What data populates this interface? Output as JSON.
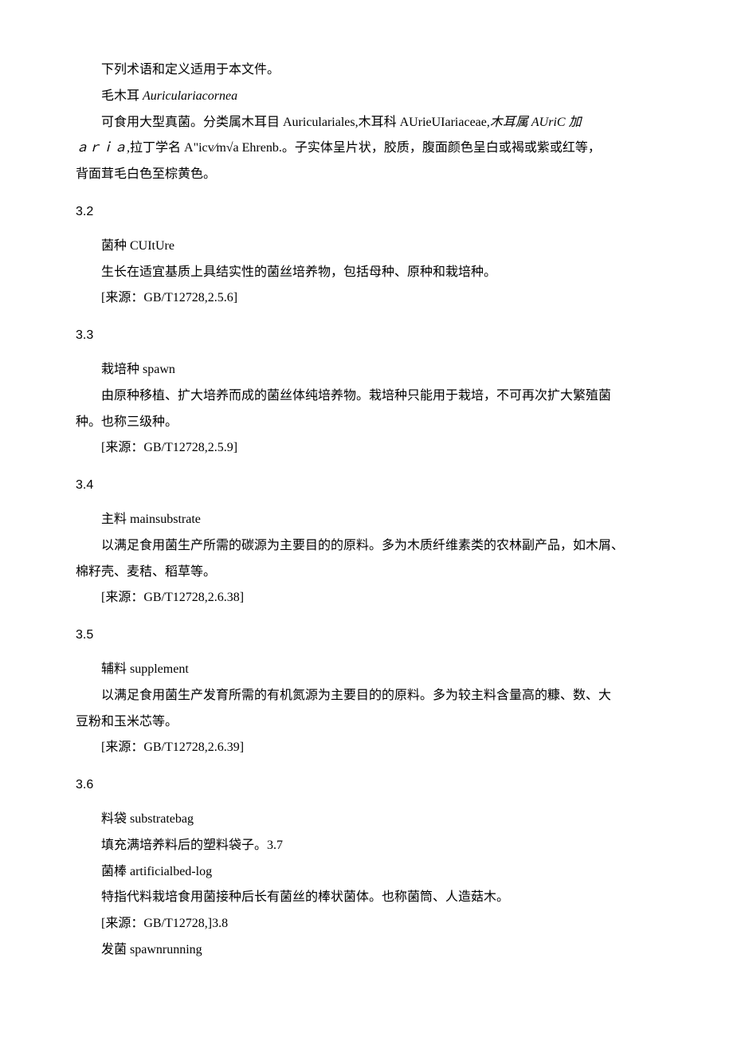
{
  "intro": {
    "line1": "下列术语和定义适用于本文件。",
    "line2_cn": "毛木耳",
    "line2_latin": "Auriculariacornea",
    "line3_a": "可食用大型真菌。分类属木耳目 Auriculariales,木耳科 AUrieUIariaceae,",
    "line3_b": "木耳属 AUriC 加",
    "line4_a": "ａｒｉａ,",
    "line4_b": "拉丁学名 A\"icv⁄m√a Ehrenb.。子实体呈片状，胶质，腹面颜色呈白或褐或紫或红等，",
    "line5": "背面茸毛白色至棕黄色。"
  },
  "s32": {
    "num": "3.2",
    "term": "菌种 CUItUre",
    "def": "生长在适宜基质上具结实性的菌丝培养物，包括母种、原种和栽培种。",
    "source": "[来源：GB/T12728,2.5.6]"
  },
  "s33": {
    "num": "3.3",
    "term": "栽培种 spawn",
    "def1": "由原种移植、扩大培养而成的菌丝体纯培养物。栽培种只能用于栽培，不可再次扩大繁殖菌",
    "def2": "种。也称三级种。",
    "source": "[来源：GB/T12728,2.5.9]"
  },
  "s34": {
    "num": "3.4",
    "term": "主料 mainsubstrate",
    "def1": "以满足食用菌生产所需的碳源为主要目的的原料。多为木质纤维素类的农林副产品，如木屑、",
    "def2": "棉籽壳、麦秸、稻草等。",
    "source": "[来源：GB/T12728,2.6.38]"
  },
  "s35": {
    "num": "3.5",
    "term": "辅料 supplement",
    "def1": "以满足食用菌生产发育所需的有机氮源为主要目的的原料。多为较主料含量高的糠、数、大",
    "def2": "豆粉和玉米芯等。",
    "source": "[来源：GB/T12728,2.6.39]"
  },
  "s36": {
    "num": "3.6",
    "term1": "料袋 substratebag",
    "def1": "填充满培养料后的塑料袋子。3.7",
    "term2": "菌棒 artificialbed-log",
    "def2": "特指代料栽培食用菌接种后长有菌丝的棒状菌体。也称菌筒、人造菇木。",
    "source": "[来源：GB/T12728,]3.8",
    "term3": "发菌 spawnrunning"
  }
}
